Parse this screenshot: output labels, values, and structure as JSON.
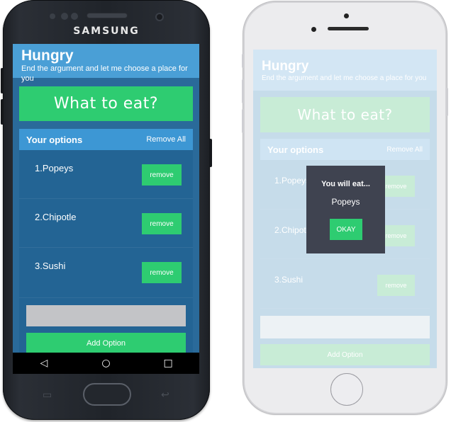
{
  "samsung": {
    "brand": "SAMSUNG",
    "nav": {
      "back_icon": "◁",
      "home_icon": "○",
      "recent_icon": "□"
    },
    "soft_recent_icon": "▭",
    "soft_back_icon": "↩"
  },
  "app": {
    "title": "Hungry",
    "subtitle": "End the argument and let me choose a place for you",
    "what_button": "What to eat?",
    "options_header": "Your options",
    "remove_all": "Remove All",
    "options": [
      {
        "label": "1.Popeys",
        "remove": "remove"
      },
      {
        "label": "2.Chipotle",
        "remove": "remove"
      },
      {
        "label": "3.Sushi",
        "remove": "remove"
      }
    ],
    "input_placeholder": "",
    "add_button": "Add Option"
  },
  "modal": {
    "title": "You will eat...",
    "value": "Popeys",
    "ok": "OKAY"
  },
  "colors": {
    "accent_green": "#2ecc71",
    "header_blue": "#4a9fd6",
    "list_blue": "#2a6a9a",
    "modal_bg": "#3f4350"
  }
}
